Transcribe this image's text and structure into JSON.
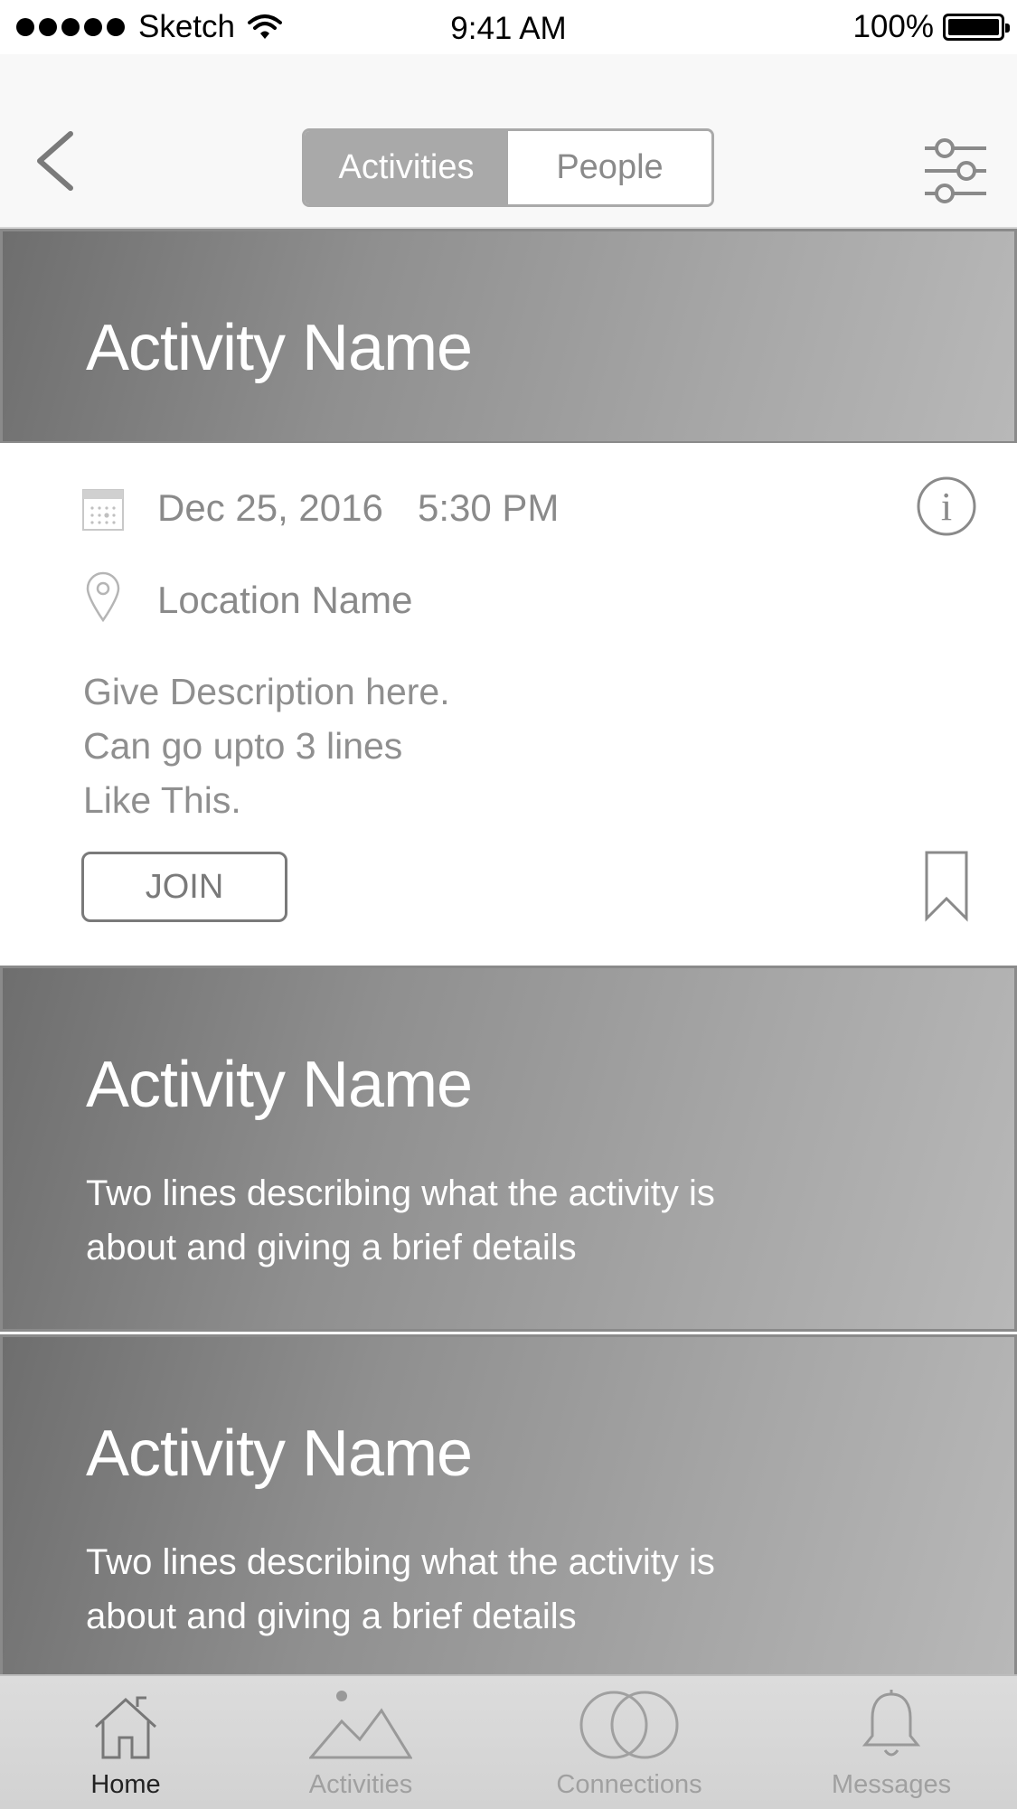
{
  "status_bar": {
    "carrier": "Sketch",
    "time": "9:41 AM",
    "battery": "100%"
  },
  "nav": {
    "back_icon": "chevron-left-icon",
    "segments": [
      {
        "label": "Activities",
        "active": true
      },
      {
        "label": "People",
        "active": false
      }
    ],
    "filter_icon": "sliders-icon"
  },
  "featured_activity": {
    "title": "Activity Name",
    "date": "Dec 25, 2016",
    "time": "5:30 PM",
    "location": "Location Name",
    "description_lines": [
      "Give Description here.",
      "Can go upto 3 lines",
      "Like This."
    ],
    "join_label": "JOIN",
    "info_icon": "info-icon",
    "bookmark_icon": "bookmark-icon"
  },
  "activities": [
    {
      "title": "Activity Name",
      "description_lines": [
        "Two lines describing what the activity is",
        "about and giving a brief details"
      ]
    },
    {
      "title": "Activity Name",
      "description_lines": [
        "Two lines describing what the activity is",
        "about and giving a brief details"
      ]
    }
  ],
  "tab_bar": {
    "tabs": [
      {
        "label": "Home",
        "icon": "home-icon",
        "active": true
      },
      {
        "label": "Activities",
        "icon": "mountain-icon",
        "active": false
      },
      {
        "label": "Connections",
        "icon": "connections-icon",
        "active": false
      },
      {
        "label": "Messages",
        "icon": "bell-icon",
        "active": false
      }
    ]
  },
  "colors": {
    "segment_active": "#a9a9a9",
    "card_gradient_dark": "#6e6e6e",
    "card_gradient_light": "#b8b8b8"
  }
}
